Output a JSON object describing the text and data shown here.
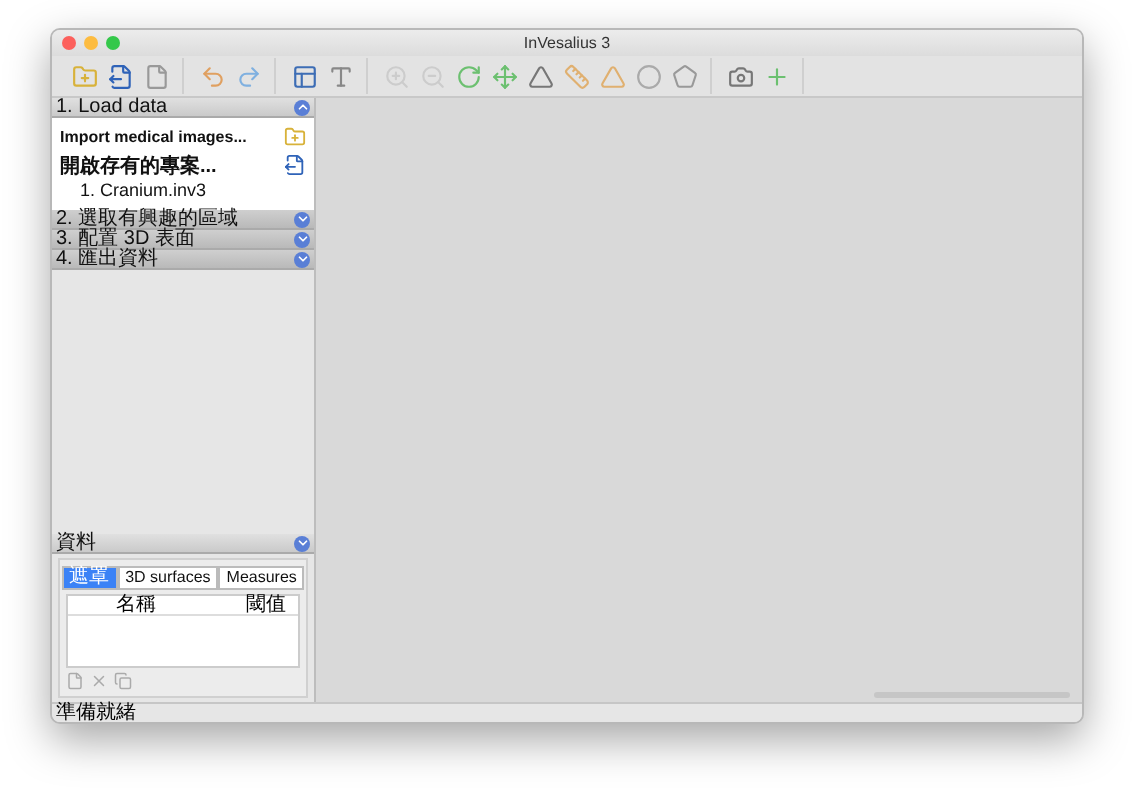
{
  "window": {
    "title": "InVesalius 3"
  },
  "sections": [
    {
      "label": "1. Load data",
      "expanded": true,
      "items": [
        {
          "kind": "action",
          "label": "Import medical images..."
        },
        {
          "kind": "action",
          "label": "開啟存有的專案..."
        },
        {
          "kind": "recent",
          "label": "1. Cranium.inv3"
        }
      ]
    },
    {
      "label": "2. 選取有興趣的區域",
      "expanded": false
    },
    {
      "label": "3. 配置 3D 表面",
      "expanded": false
    },
    {
      "label": "4. 匯出資料",
      "expanded": false
    }
  ],
  "data_panel": {
    "title": "資料",
    "tabs": [
      {
        "label": "遮罩",
        "selected": true
      },
      {
        "label": "3D surfaces",
        "selected": false
      },
      {
        "label": "Measures",
        "selected": false
      }
    ],
    "columns": [
      "名稱",
      "閾值"
    ]
  },
  "status_bar": {
    "text": "準備就緒"
  }
}
